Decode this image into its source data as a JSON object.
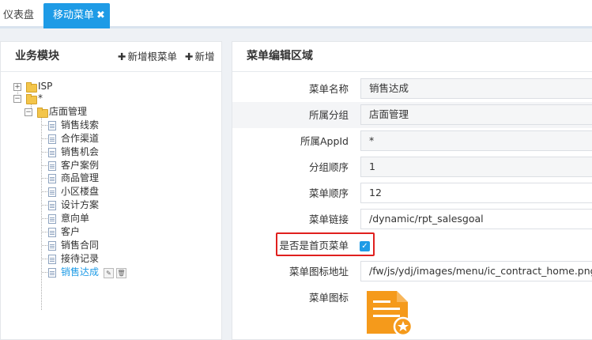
{
  "tabs": [
    {
      "label": "仪表盘",
      "active": false
    },
    {
      "label": "移动菜单",
      "active": true,
      "close_glyph": "✖"
    }
  ],
  "left_panel": {
    "title": "业务模块",
    "add_root_label": "新增根菜单",
    "add_label": "新增",
    "plus_glyph": "✚"
  },
  "tree": {
    "root1": {
      "label": "ISP",
      "expander": "+"
    },
    "root2": {
      "label": "*",
      "expander": "−"
    },
    "group": {
      "label": "店面管理",
      "expander": "−"
    },
    "items": [
      "销售线索",
      "合作渠道",
      "销售机会",
      "客户案例",
      "商品管理",
      "小区楼盘",
      "设计方案",
      "意向单",
      "客户",
      "销售合同",
      "接待记录",
      "销售达成"
    ],
    "selected_index": 11,
    "edit_icon": "✎",
    "delete_icon": "🗑"
  },
  "right_panel": {
    "title": "菜单编辑区域"
  },
  "form": {
    "menu_name_label": "菜单名称",
    "menu_name_value": "销售达成",
    "group_label": "所属分组",
    "group_value": "店面管理",
    "appid_label": "所属AppId",
    "appid_value": "*",
    "group_order_label": "分组顺序",
    "group_order_value": "1",
    "menu_order_label": "菜单顺序",
    "menu_order_value": "12",
    "link_label": "菜单链接",
    "link_value": "/dynamic/rpt_salesgoal",
    "homepage_label": "是否是首页菜单",
    "homepage_checked": true,
    "check_glyph": "✓",
    "icon_url_label": "菜单图标地址",
    "icon_url_value": "/fw/js/ydj/images/menu/ic_contract_home.png",
    "icon_label": "菜单图标"
  },
  "colors": {
    "accent": "#1e9be6",
    "highlight": "#e0201e",
    "menu_icon": "#f59a1b"
  }
}
